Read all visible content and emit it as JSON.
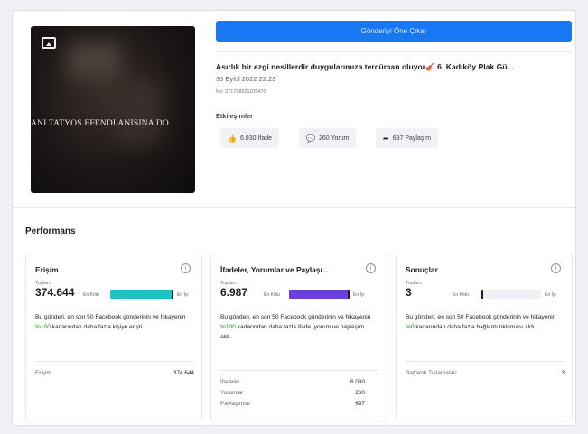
{
  "header": {
    "boost_label": "Gönderiyi Öne Çıkar"
  },
  "post": {
    "thumbnail_overlay": "ANI TATYOS EFENDI ANISINA DO",
    "title": "Asırlık bir ezgi nesillerdir duygularımıza tercüman oluyor🎻 6. Kadıköy Plak Gü...",
    "date": "30 Eylül 2022 22:23",
    "id": "No: 371798521105470",
    "engagement_label": "Etkileşimler",
    "chips": [
      {
        "icon": "thumbs-up-icon",
        "glyph": "👍",
        "label": "6.030 İfade"
      },
      {
        "icon": "comment-icon",
        "glyph": "💬",
        "label": "260 Yorum"
      },
      {
        "icon": "share-icon",
        "glyph": "➦",
        "label": "697 Paylaşım"
      }
    ]
  },
  "performance": {
    "title": "Performans",
    "cards": [
      {
        "title": "Erişim",
        "total_label": "Toplam",
        "value": "374.644",
        "worst_label": "En Kötü",
        "best_label": "En İyi",
        "fill_fraction": 1.0,
        "fill_color": "#1fc0c8",
        "desc_before": "Bu gönderi, en son 50 Facebook gönderinin ve hikayenin ",
        "desc_pct": "%100",
        "desc_after": " kadarından daha fazla kişiye erişti.",
        "metrics": [
          {
            "label": "Erişim",
            "value": "374.644"
          }
        ]
      },
      {
        "title": "İfadeler, Yorumlar ve Paylaşı...",
        "total_label": "Toplam",
        "value": "6.987",
        "worst_label": "En Kötü",
        "best_label": "En İyi",
        "fill_fraction": 1.0,
        "fill_color": "#6a3fd6",
        "desc_before": "Bu gönderi, en son 50 Facebook gönderinin ve hikayenin ",
        "desc_pct": "%100",
        "desc_after": " kadarından daha fazla ifade, yorum ve paylaşım aldı.",
        "metrics": [
          {
            "label": "İfadeler",
            "value": "6.030"
          },
          {
            "label": "Yorumlar",
            "value": "260"
          },
          {
            "label": "Paylaşımlar",
            "value": "697"
          }
        ]
      },
      {
        "title": "Sonuçlar",
        "total_label": "Toplam",
        "value": "3",
        "worst_label": "En Kötü",
        "best_label": "En İyi",
        "fill_fraction": 0.0,
        "fill_color": "#9fd0f5",
        "desc_before": "Bu gönderi, en son 50 Facebook gönderinin ve hikayenin ",
        "desc_pct": "%0",
        "desc_after": " kadarından daha fazla bağlantı tıklaması aldı.",
        "metrics": [
          {
            "label": "Bağlantı Tıklamaları",
            "value": "3"
          }
        ]
      }
    ]
  }
}
